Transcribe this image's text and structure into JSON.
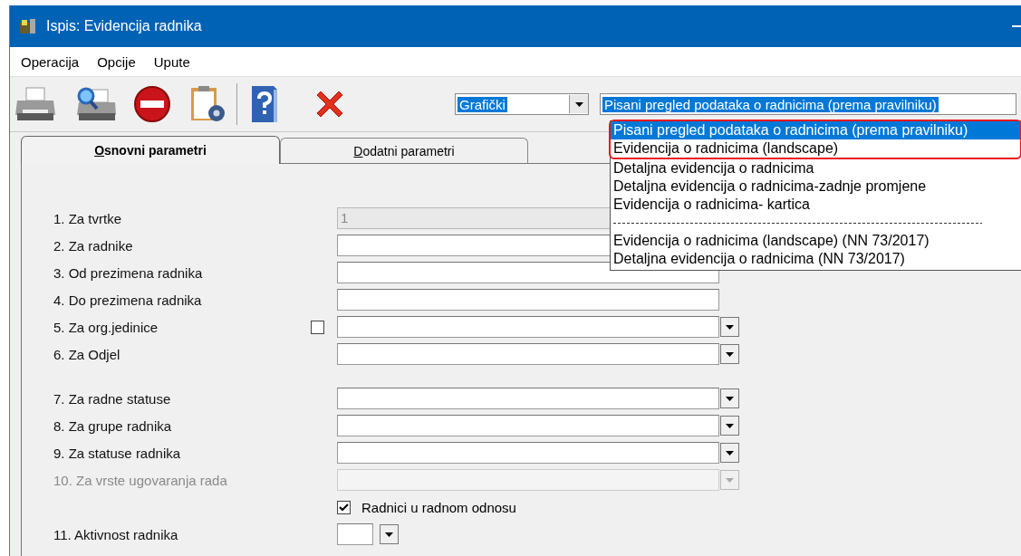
{
  "window": {
    "title": "Ispis: Evidencija radnika"
  },
  "menu": [
    "Operacija",
    "Opcije",
    "Upute"
  ],
  "output_type": {
    "value": "Grafički"
  },
  "report": {
    "value": "Pisani pregled podataka o radnicima (prema pravilniku)",
    "options": [
      {
        "kind": "option",
        "label": "Pisani pregled podataka o radnicima (prema pravilniku)",
        "selected": true,
        "marked": true
      },
      {
        "kind": "option",
        "label": "Evidencija o radnicima (landscape)",
        "selected": false,
        "marked": true
      },
      {
        "kind": "option",
        "label": "Detaljna evidencija o radnicima",
        "selected": false,
        "marked": false
      },
      {
        "kind": "option",
        "label": "Detaljna evidencija o radnicima-zadnje promjene",
        "selected": false,
        "marked": false
      },
      {
        "kind": "option",
        "label": "Evidencija o radnicima- kartica",
        "selected": false,
        "marked": false
      },
      {
        "kind": "separator"
      },
      {
        "kind": "option",
        "label": "Evidencija o radnicima (landscape) (NN 73/2017)",
        "selected": false,
        "marked": false
      },
      {
        "kind": "option",
        "label": "Detaljna evidencija o radnicima (NN 73/2017)",
        "selected": false,
        "marked": false
      }
    ]
  },
  "tabs": [
    {
      "label": "Osnovni parametri",
      "selected": true
    },
    {
      "label": "Dodatni parametri",
      "selected": false
    }
  ],
  "parameter_groups": [
    [
      {
        "kind": "text",
        "label": "1. Za tvrtke",
        "value": "1",
        "readonly": true,
        "disabled": false
      },
      {
        "kind": "text",
        "label": "2. Za radnike",
        "readonly": false,
        "disabled": false
      },
      {
        "kind": "text",
        "label": "3. Od prezimena radnika",
        "readonly": false,
        "disabled": false
      },
      {
        "kind": "text",
        "label": "4. Do prezimena radnika",
        "readonly": false,
        "disabled": false
      },
      {
        "kind": "combo",
        "label": "5. Za org.jedinice",
        "readonly": false,
        "disabled": false,
        "checkbox": {
          "checked": false
        }
      },
      {
        "kind": "combo",
        "label": "6. Za Odjel",
        "readonly": false,
        "disabled": false
      }
    ],
    [
      {
        "kind": "combo",
        "label": "7. Za radne statuse",
        "readonly": false,
        "disabled": false
      },
      {
        "kind": "combo",
        "label": "8. Za grupe radnika",
        "readonly": false,
        "disabled": false
      },
      {
        "kind": "combo",
        "label": "9. Za statuse radnika",
        "readonly": false,
        "disabled": false
      },
      {
        "kind": "combo",
        "label": "10. Za vrste ugovaranja rada",
        "readonly": false,
        "disabled": true
      },
      {
        "kind": "checkbox",
        "label": "Radnici u radnom odnosu",
        "checked": true
      },
      {
        "kind": "small_combo",
        "label": "11. Aktivnost radnika",
        "readonly": false,
        "disabled": false
      }
    ]
  ]
}
